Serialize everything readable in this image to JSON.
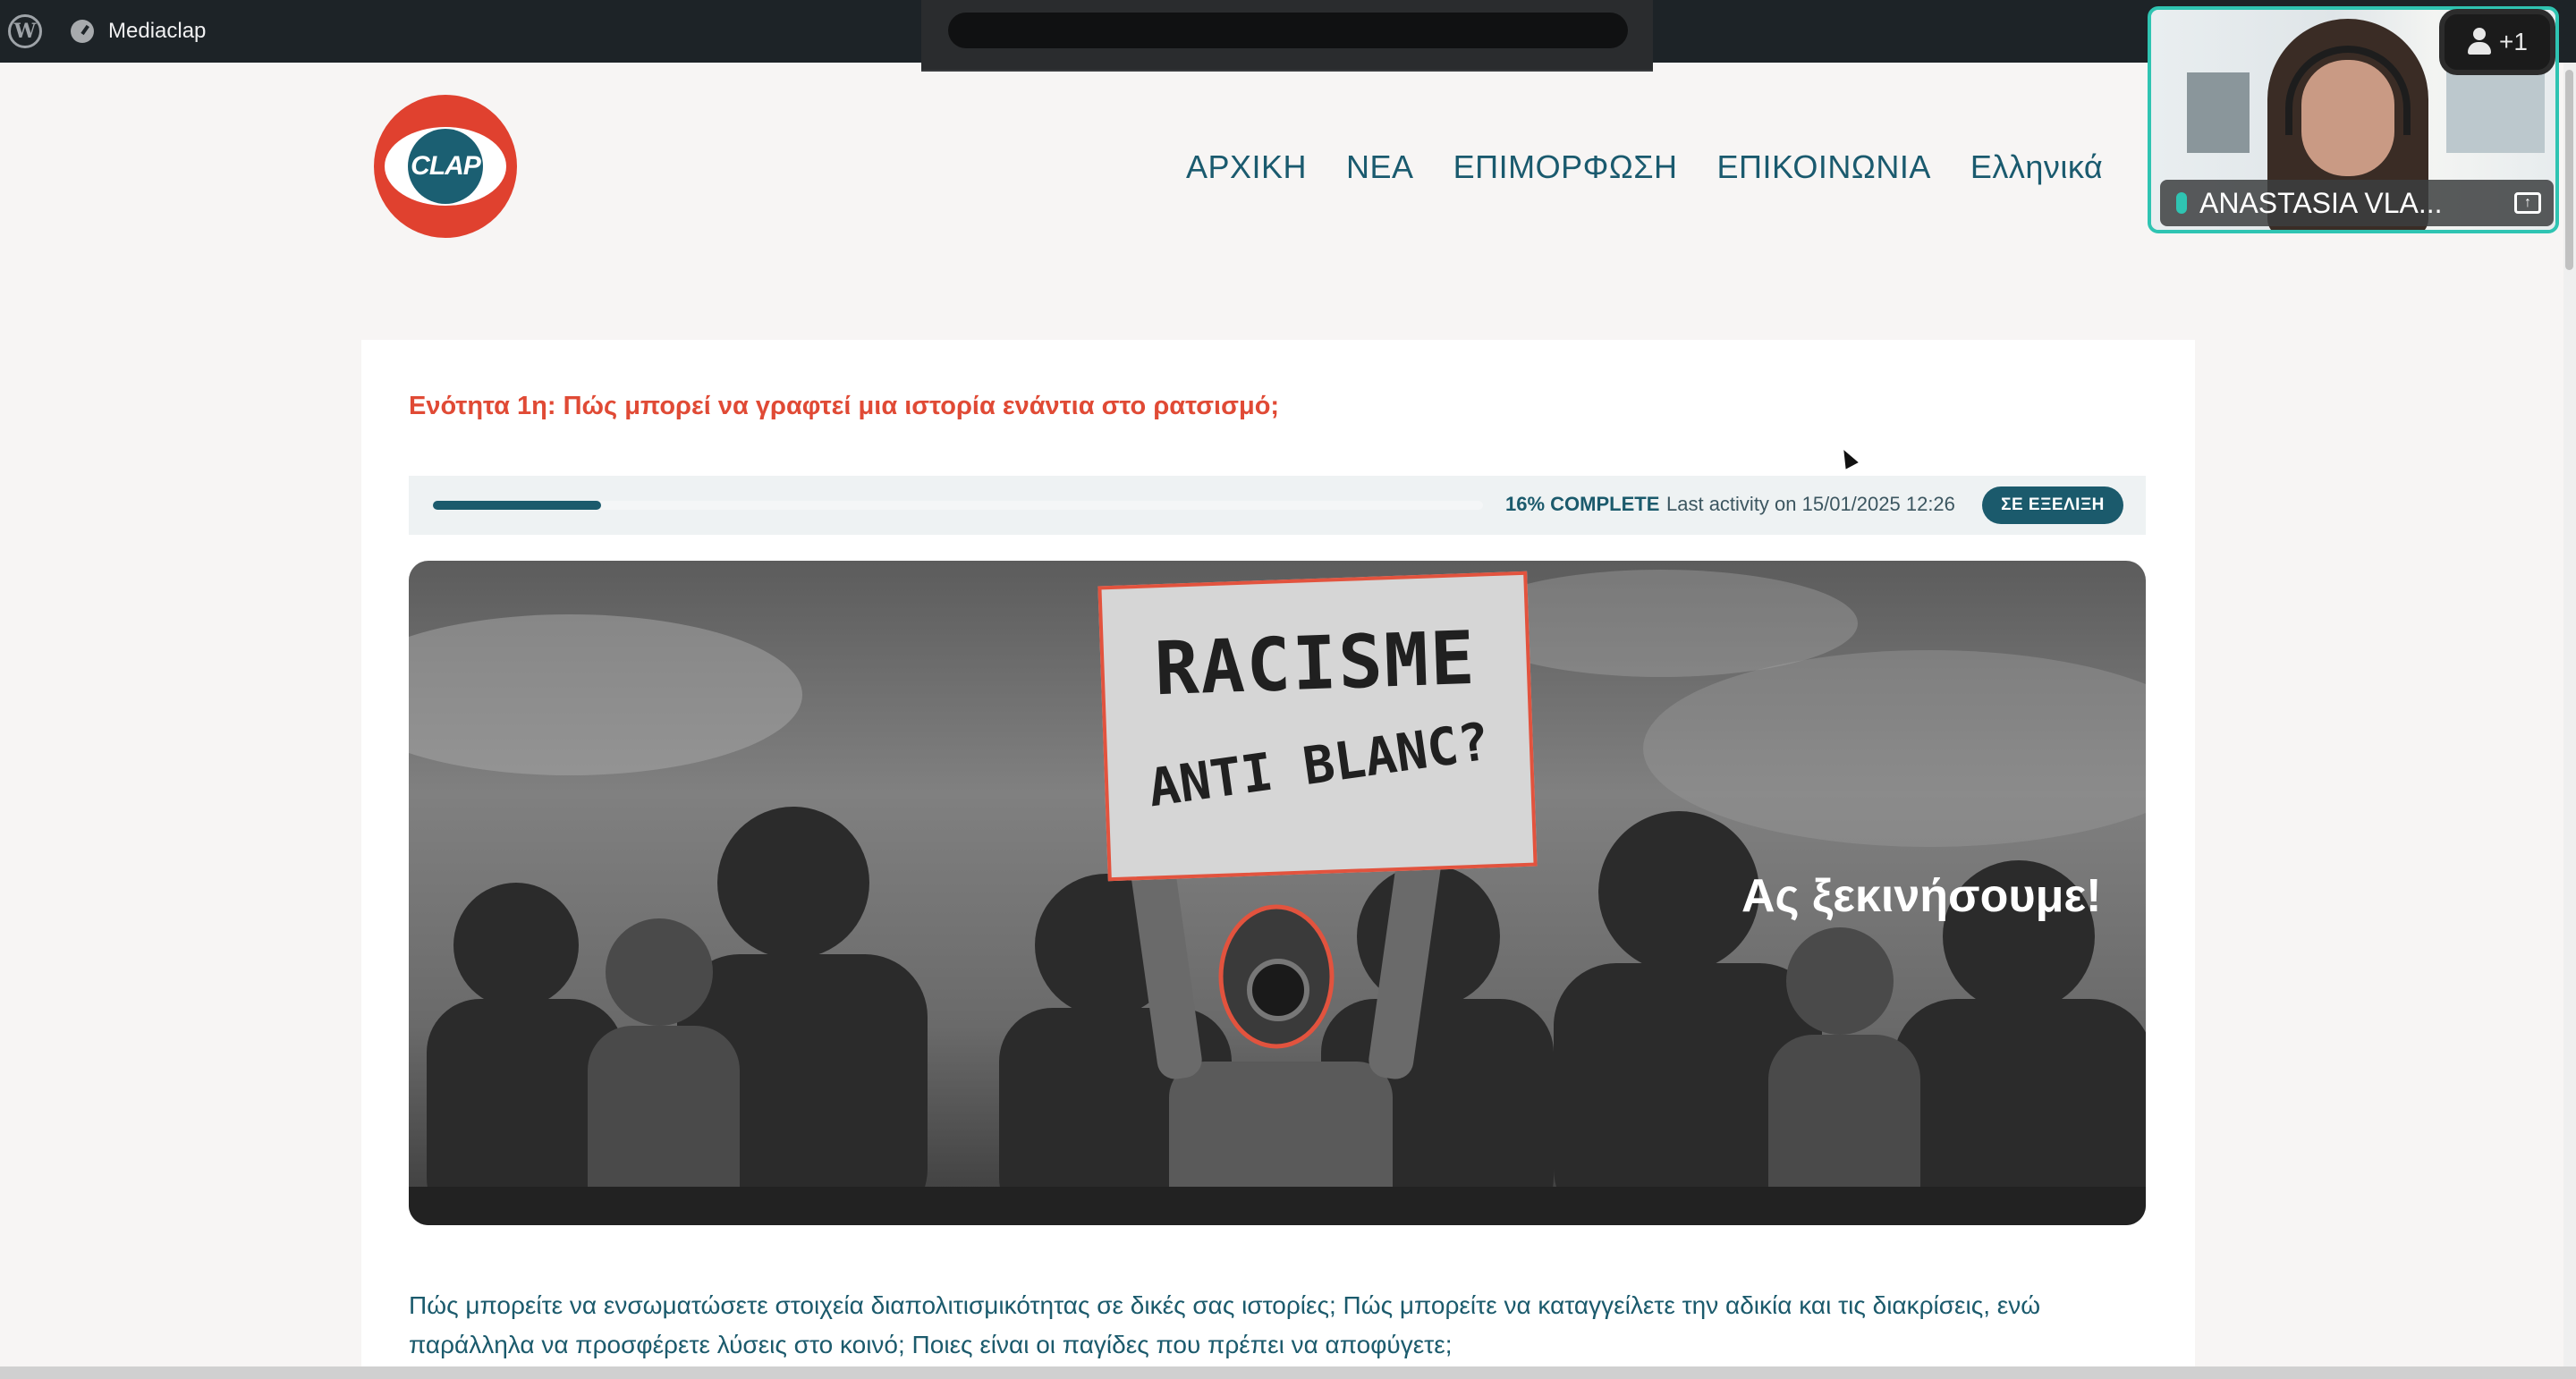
{
  "admin_bar": {
    "wp_logo_glyph": "W",
    "site_name": "Mediaclap"
  },
  "header": {
    "logo_text": "CLAP",
    "nav": [
      "ΑΡΧΙΚΗ",
      "ΝΕΑ",
      "ΕΠΙΜΟΡΦΩΣΗ",
      "ΕΠΙΚΟΙΝΩΝΙΑ",
      "Ελληνικά"
    ]
  },
  "video_call": {
    "participant_name": "ANASTASIA VLA...",
    "extra_participants": "+1",
    "border_color": "#2fc4b2"
  },
  "lesson": {
    "title": "Ενότητα 1η: Πώς μπορεί να γραφτεί μια ιστορία ενάντια στο ρατσισμό;",
    "progress_fraction": 0.16,
    "progress_label": "16% COMPLETE",
    "last_activity": "Last activity on 15/01/2025 12:26",
    "status_badge": "ΣΕ ΕΞΕΛΙΞΗ"
  },
  "hero": {
    "sign_line1": "RACISME",
    "sign_line2": "ANTI BLANC?",
    "cta": "Ας ξεκινήσουμε!"
  },
  "body": {
    "paragraph": "Πώς μπορείτε να ενσωματώσετε στοιχεία διαπολιτισμικότητας σε δικές σας ιστορίες; Πώς μπορείτε να καταγγείλετε την αδικία και τις διακρίσεις, ενώ παράλληλα να προσφέρετε λύσεις στο κοινό; Ποιες είναι οι παγίδες που πρέπει να αποφύγετε;"
  },
  "colors": {
    "brand_teal": "#1b5a6c",
    "accent_red": "#e04a35",
    "admin_bar": "#1d2327"
  }
}
